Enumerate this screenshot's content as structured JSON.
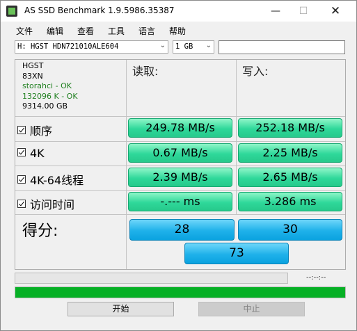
{
  "window": {
    "title": "AS SSD Benchmark 1.9.5986.35387",
    "minimize_glyph": "—",
    "maximize_glyph": "☐",
    "close_glyph": "✕"
  },
  "menu": {
    "items": [
      "文件",
      "编辑",
      "查看",
      "工具",
      "语言",
      "帮助"
    ]
  },
  "toolbar": {
    "drive_select": "H: HGST HDN721010ALE604",
    "size_select": "1 GB",
    "dropdown_arrow": "⌄"
  },
  "drive_info": {
    "vendor": "HGST",
    "firmware": "83XN",
    "driver": "storahci - OK",
    "alignment": "132096 K - OK",
    "capacity": "9314.00 GB"
  },
  "columns": {
    "read": "读取:",
    "write": "写入:"
  },
  "tests": [
    {
      "label": "顺序",
      "read": "249.78 MB/s",
      "write": "252.18 MB/s",
      "checked": true
    },
    {
      "label": "4K",
      "read": "0.67 MB/s",
      "write": "2.25 MB/s",
      "checked": true
    },
    {
      "label": "4K-64线程",
      "read": "2.39 MB/s",
      "write": "2.65 MB/s",
      "checked": true
    },
    {
      "label": "访问时间",
      "read": "-.--- ms",
      "write": "3.286 ms",
      "checked": true
    }
  ],
  "score": {
    "label": "得分:",
    "read": "28",
    "write": "30",
    "total": "73"
  },
  "status": {
    "elapsed": "--:--:--",
    "progress_pct": 100
  },
  "buttons": {
    "start": "开始",
    "abort": "中止"
  },
  "colors": {
    "result_green": "#2fd89a",
    "score_blue": "#1fb1ea",
    "progress_green": "#06b025",
    "info_ok": "#208020"
  }
}
